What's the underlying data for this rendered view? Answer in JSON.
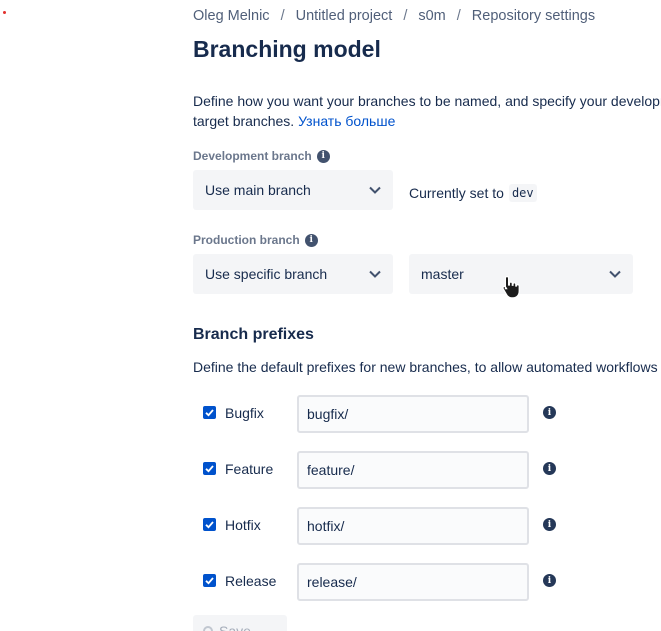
{
  "breadcrumb": {
    "items": [
      "Oleg Melnic",
      "Untitled project",
      "s0m",
      "Repository settings"
    ],
    "separator": "/"
  },
  "page_title": "Branching model",
  "description": {
    "text": "Define how you want your branches to be named, and specify your development and",
    "text2": "target branches.",
    "link": "Узнать больше"
  },
  "development_branch": {
    "label": "Development branch",
    "select_value": "Use main branch",
    "current_prefix": "Currently set to",
    "current_value": "dev"
  },
  "production_branch": {
    "label": "Production branch",
    "select_value": "Use specific branch",
    "branch_value": "master"
  },
  "branch_prefixes": {
    "title": "Branch prefixes",
    "description": "Define the default prefixes for new branches, to allow automated workflows and",
    "items": [
      {
        "label": "Bugfix",
        "value": "bugfix/",
        "checked": true
      },
      {
        "label": "Feature",
        "value": "feature/",
        "checked": true
      },
      {
        "label": "Hotfix",
        "value": "hotfix/",
        "checked": true
      },
      {
        "label": "Release",
        "value": "release/",
        "checked": true
      }
    ]
  },
  "save": {
    "label": "Save"
  },
  "icons": {
    "info": "info-icon",
    "chevron": "chevron-down-icon",
    "check": "check-icon",
    "cursor": "hand-pointer-icon"
  },
  "colors": {
    "primary": "#0052cc",
    "text": "#172b4d",
    "muted": "#6b778c",
    "field_bg": "#f4f5f7"
  }
}
